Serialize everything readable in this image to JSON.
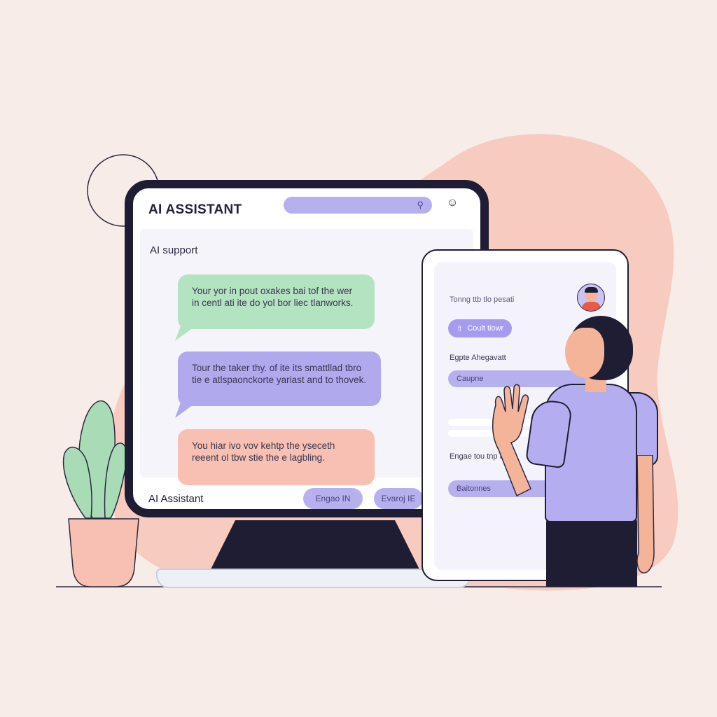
{
  "monitor": {
    "title": "AI ASSISTANT",
    "section_label": "AI support",
    "footer_label": "AI Assistant",
    "messages": [
      {
        "text": "Your yor in pout oxakes bai tof the wer in centl ati ite do yol bor liec tlanworks."
      },
      {
        "text": "Tour the taker thy. of ite its smattllad tbro tie e atlspaonckorte yariast and to thovek."
      },
      {
        "text": "You hiar ivo vov kehtp the yseceth reeent ol tbw stie the e lagbling."
      }
    ],
    "buttons": [
      "Engao IN",
      "Evaroj IE"
    ]
  },
  "tablet": {
    "heading": "Tonng ttb tlo pesati",
    "button": "Coult tiowr",
    "label_1": "Egpte Ahegavatt",
    "pill_1": "Caupne",
    "label_2": "Engae tou tnp IIa",
    "pill_2": "Baitonnes"
  },
  "icons": {
    "search": "search-icon",
    "user": "user-icon",
    "arrow": "arrow-icon",
    "avatar": "avatar"
  },
  "colors": {
    "background": "#f7ece7",
    "accent_purple": "#b6b0ef",
    "bubble_green": "#b4e3c2",
    "bubble_purple": "#b0a9ee",
    "bubble_pink": "#f7c0b2",
    "dark": "#1f1d33",
    "blob": "#f7c6b7"
  }
}
